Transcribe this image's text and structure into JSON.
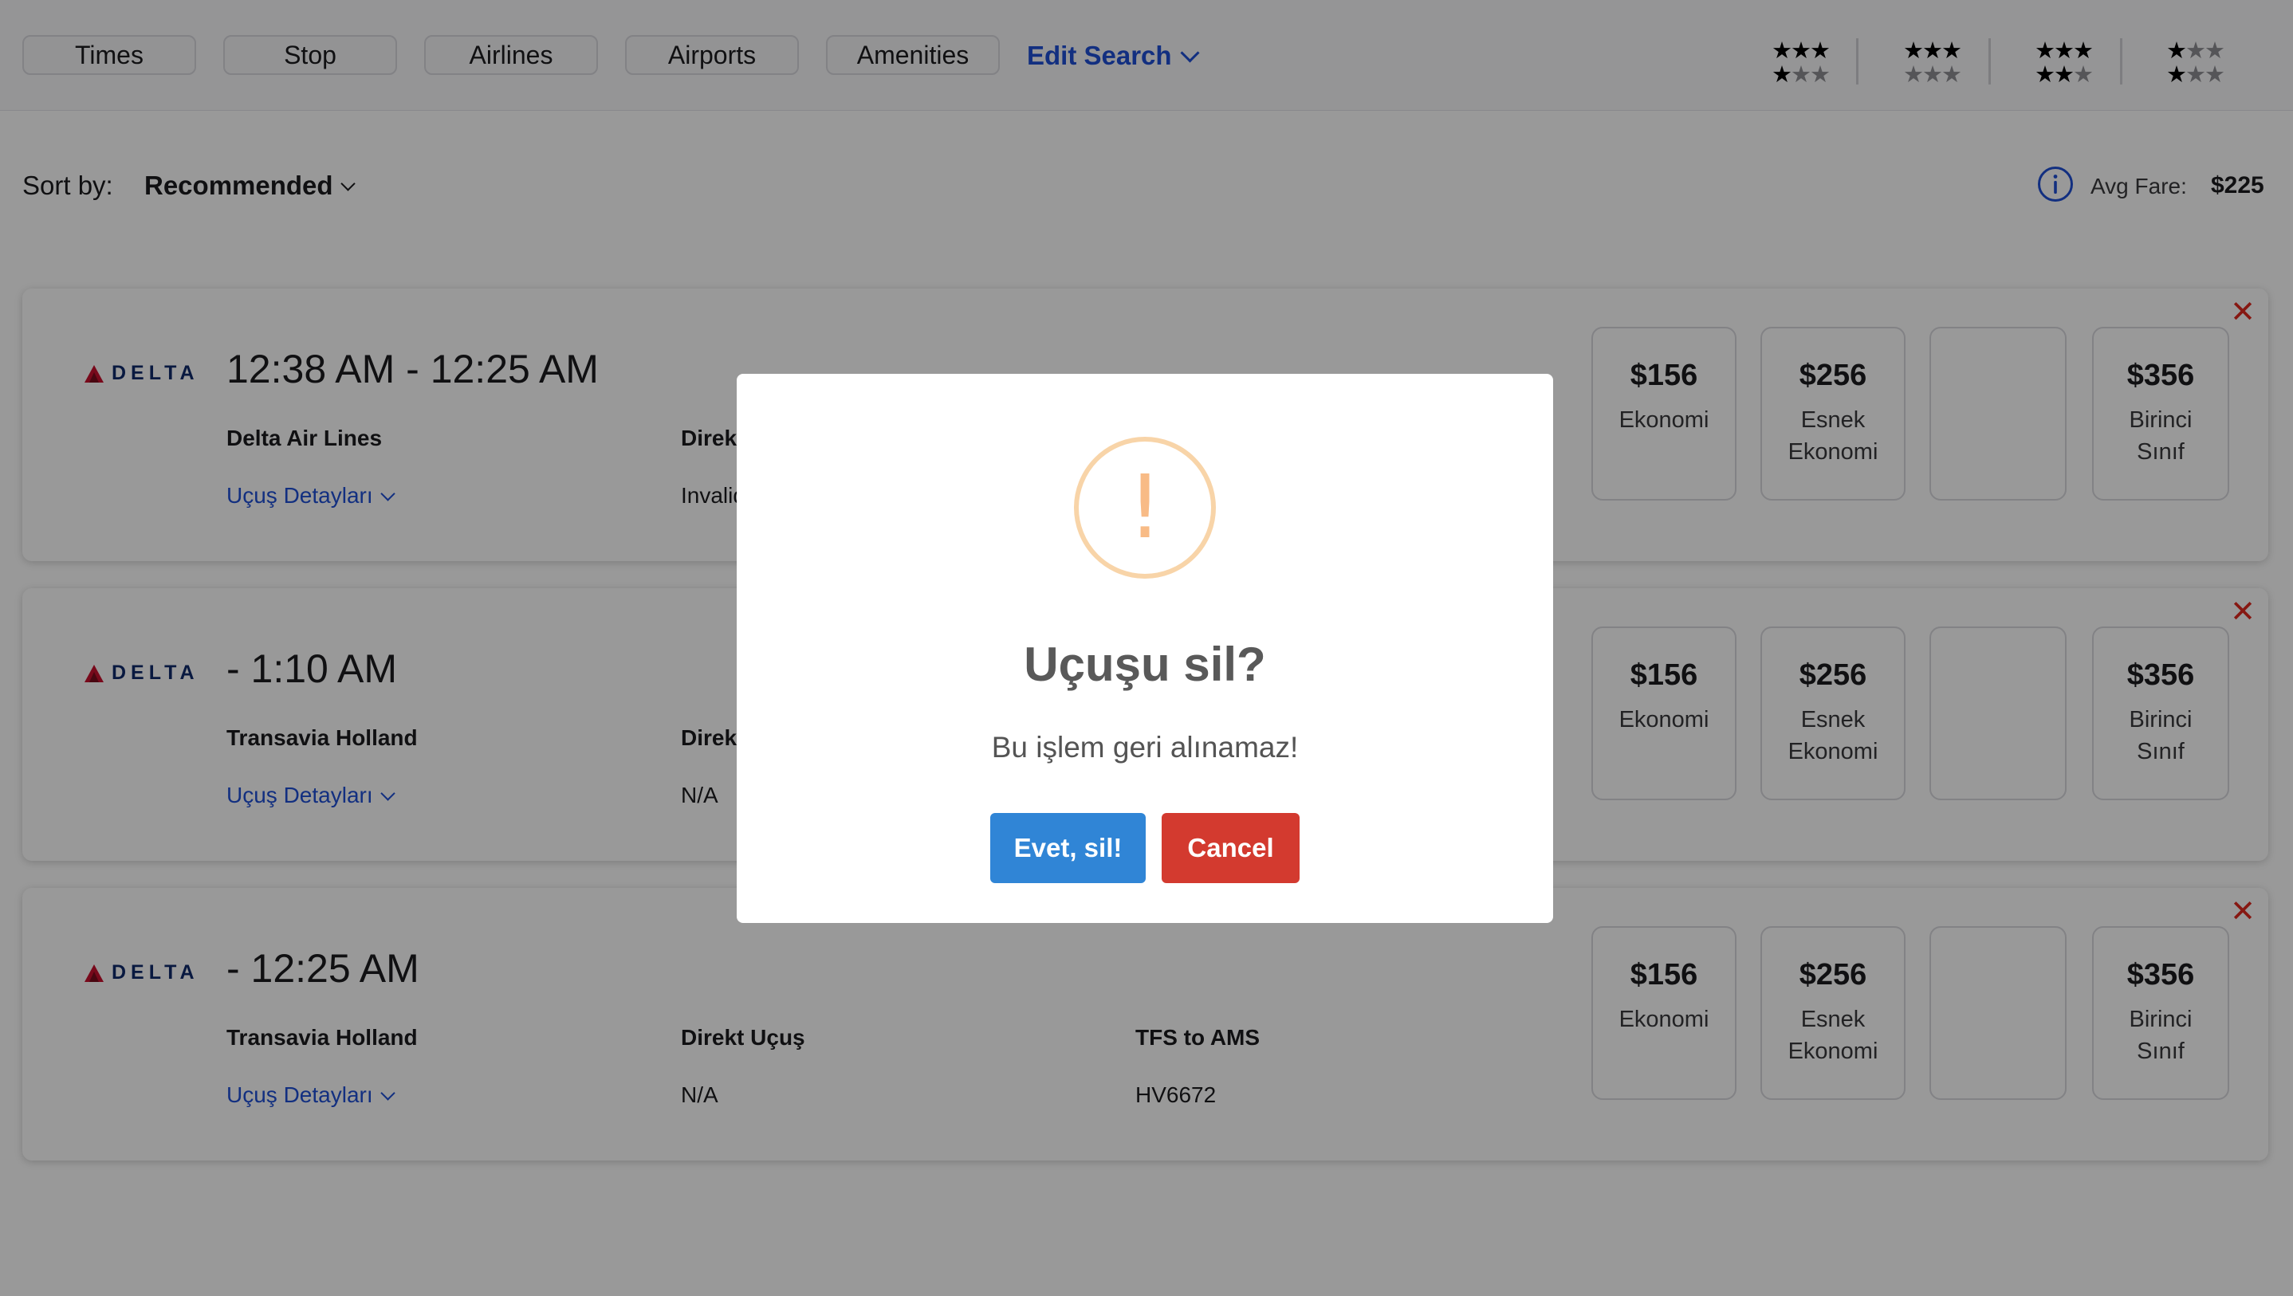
{
  "filters": {
    "pills": [
      "Times",
      "Stop",
      "Airlines",
      "Airports",
      "Amenities"
    ],
    "edit_search": "Edit Search"
  },
  "rating_filters": [
    {
      "row1": "★★★",
      "row1_off": "",
      "row2": "★",
      "row2_off": "★★",
      "stars": 4
    },
    {
      "row1": "★★★",
      "row1_off": "",
      "row2": "",
      "row2_off": "★★★",
      "stars": 3
    },
    {
      "row1": "★★★",
      "row1_off": "",
      "row2": "★★",
      "row2_off": "★",
      "stars": 5
    },
    {
      "row1": "★",
      "row1_off": "★★",
      "row2": "★",
      "row2_off": "★★",
      "stars": 2
    }
  ],
  "sort": {
    "label": "Sort by:",
    "value": "Recommended"
  },
  "avg_fare": {
    "label": "Avg Fare:",
    "value": "$225"
  },
  "flights": [
    {
      "airline_logo": "DELTA",
      "times": "12:38 AM - 12:25 AM",
      "airline": "Delta Air Lines",
      "details": "Uçuş Detayları",
      "stop_type": "Direkt Uçuş",
      "duration": "Invalid",
      "route": "",
      "flight_number": "",
      "fares": [
        {
          "price": "$156",
          "class1": "Ekonomi",
          "class2": ""
        },
        {
          "price": "$256",
          "class1": "Esnek",
          "class2": "Ekonomi"
        },
        {
          "price": "",
          "class1": "",
          "class2": ""
        },
        {
          "price": "$356",
          "class1": "Birinci",
          "class2": "Sınıf"
        }
      ]
    },
    {
      "airline_logo": "DELTA",
      "times": "- 1:10 AM",
      "airline": "Transavia Holland",
      "details": "Uçuş Detayları",
      "stop_type": "Direkt Uçuş",
      "duration": "N/A",
      "route": "",
      "flight_number": "",
      "fares": [
        {
          "price": "$156",
          "class1": "Ekonomi",
          "class2": ""
        },
        {
          "price": "$256",
          "class1": "Esnek",
          "class2": "Ekonomi"
        },
        {
          "price": "",
          "class1": "",
          "class2": ""
        },
        {
          "price": "$356",
          "class1": "Birinci",
          "class2": "Sınıf"
        }
      ]
    },
    {
      "airline_logo": "DELTA",
      "times": "- 12:25 AM",
      "airline": "Transavia Holland",
      "details": "Uçuş Detayları",
      "stop_type": "Direkt Uçuş",
      "duration": "N/A",
      "route": "TFS to AMS",
      "flight_number": "HV6672",
      "fares": [
        {
          "price": "$156",
          "class1": "Ekonomi",
          "class2": ""
        },
        {
          "price": "$256",
          "class1": "Esnek",
          "class2": "Ekonomi"
        },
        {
          "price": "",
          "class1": "",
          "class2": ""
        },
        {
          "price": "$356",
          "class1": "Birinci",
          "class2": "Sınıf"
        }
      ]
    }
  ],
  "dialog": {
    "icon": "warning-exclamation-icon",
    "icon_glyph": "!",
    "title": "Uçuşu sil?",
    "text": "Bu işlem geri alınamaz!",
    "confirm": "Evet, sil!",
    "cancel": "Cancel"
  },
  "colors": {
    "link": "#1f4fd6",
    "confirm": "#3085d6",
    "cancel": "#d33a2f",
    "warning": "#f8bb86",
    "close": "#e0281e",
    "delta_red": "#c8102e"
  }
}
